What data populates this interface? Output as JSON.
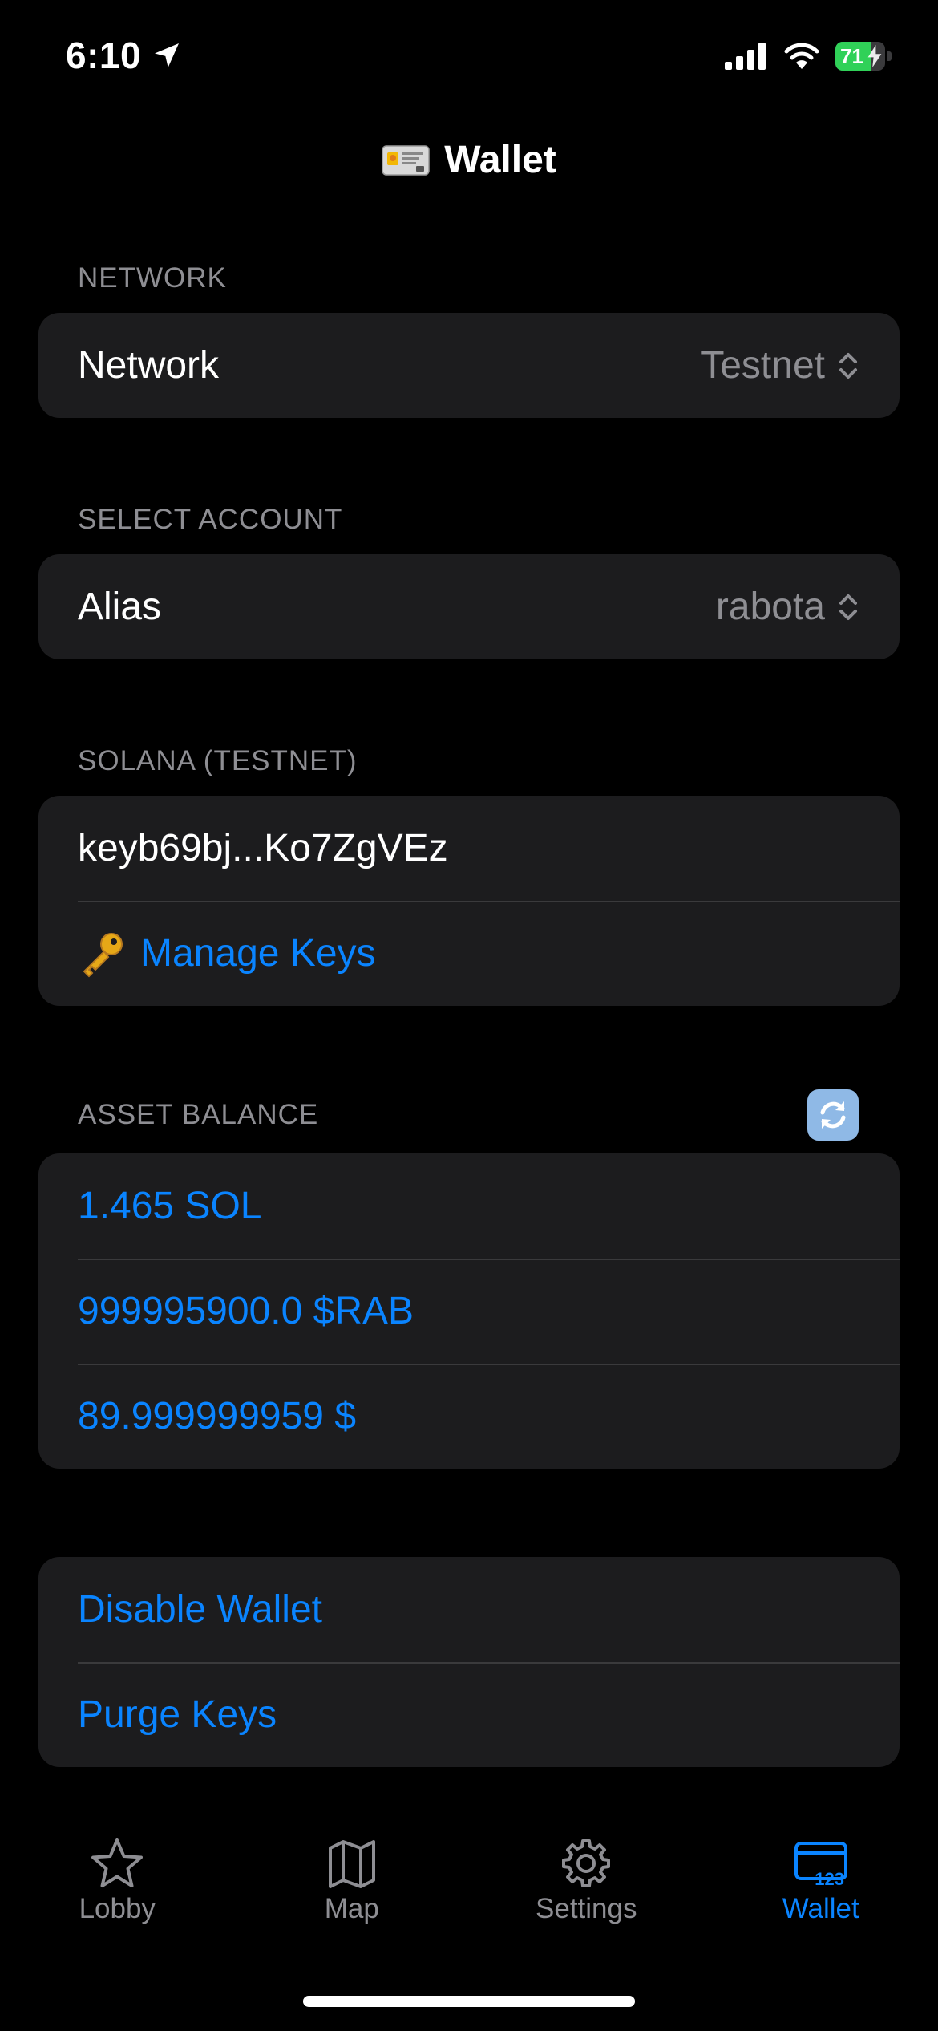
{
  "status_bar": {
    "time": "6:10",
    "battery_percent": "71",
    "battery_level": 0.71,
    "icons": [
      "location-arrow-icon",
      "cellular-signal-icon",
      "wifi-icon",
      "battery-charging-icon"
    ]
  },
  "nav": {
    "title": "Wallet",
    "icon": "wallet-card-emoji"
  },
  "sections": {
    "network": {
      "header": "NETWORK",
      "label": "Network",
      "value": "Testnet"
    },
    "account": {
      "header": "SELECT ACCOUNT",
      "label": "Alias",
      "value": "rabota"
    },
    "solana": {
      "header": "SOLANA (TESTNET)",
      "address": "keyb69bj...Ko7ZgVEz",
      "manage_keys": "Manage Keys"
    },
    "balance": {
      "header": "ASSET BALANCE",
      "refresh_icon": "refresh-icon",
      "items": [
        "1.465 SOL",
        "999995900.0 $RAB",
        "89.999999959 $"
      ]
    },
    "actions": {
      "disable": "Disable Wallet",
      "purge": "Purge Keys"
    }
  },
  "tabs": [
    {
      "label": "Lobby",
      "icon": "star-icon",
      "active": false
    },
    {
      "label": "Map",
      "icon": "map-icon",
      "active": false
    },
    {
      "label": "Settings",
      "icon": "gear-icon",
      "active": false
    },
    {
      "label": "Wallet",
      "icon": "wallet-card-icon",
      "active": true
    }
  ],
  "colors": {
    "accent": "#0a84ff",
    "background": "#000000",
    "cell": "#1c1c1e",
    "secondary_text": "#8e8e93",
    "battery": "#30d158"
  }
}
